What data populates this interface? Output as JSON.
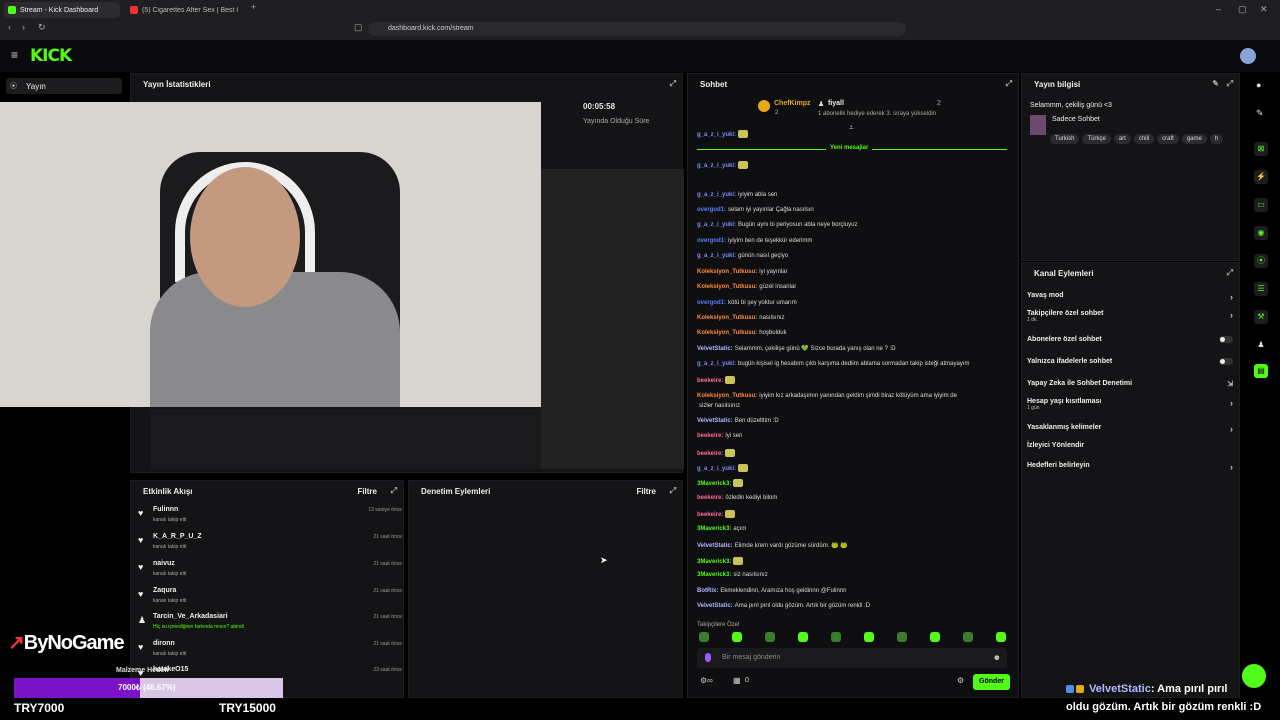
{
  "browser": {
    "tabs": [
      {
        "label": "Stream - Kick Dashboard"
      },
      {
        "label": "(5) Cigarettes After Sex | Best Of"
      }
    ],
    "url": "dashboard.kick.com/stream"
  },
  "header": {
    "logo": "KICK"
  },
  "sidebar": {
    "item": "Yayın"
  },
  "stats": {
    "title": "Yayın İstatistikleri",
    "duration": "00:05:58",
    "duration_label": "Yayında Olduğu Süre"
  },
  "chat": {
    "title": "Sohbet",
    "pinned_user": "ChefKimpz",
    "pinned_count": "2",
    "pinned_user2": "fiyall",
    "pinned_count2": "2",
    "pinned_note": "1 abonelik hediye ederek 3. sıraya yükseldin",
    "new_messages": "Yeni mesajlar",
    "messages": [
      {
        "user": "g_a_z_i_yuki:",
        "text": "",
        "color": "#7b8cff"
      },
      {
        "user": "g_a_z_i_yuki:",
        "text": "",
        "color": "#7b8cff"
      },
      {
        "user": "g_a_z_i_yuki:",
        "text": "iyiyim abla sen",
        "color": "#7b8cff"
      },
      {
        "user": "overgod1:",
        "text": "selam iyi yayınlar Çağla nasılsın",
        "color": "#5a7dff"
      },
      {
        "user": "g_a_z_i_yuki:",
        "text": "Bugün aynı bi periyosun abla neye borçluyuz",
        "color": "#7b8cff"
      },
      {
        "user": "overgod1:",
        "text": "iyiyim ben de teşekkür ederimm",
        "color": "#5a7dff"
      },
      {
        "user": "g_a_z_i_yuki:",
        "text": "günün nasıl geçiyo",
        "color": "#7b8cff"
      },
      {
        "user": "Koleksiyon_Tutkusu:",
        "text": "iyi yayınlar",
        "color": "#ff8a3d"
      },
      {
        "user": "Koleksiyon_Tutkusu:",
        "text": "güzel insanlar",
        "color": "#ff8a3d"
      },
      {
        "user": "overgod1:",
        "text": "kötü bi şey yoktur umarım",
        "color": "#5a7dff"
      },
      {
        "user": "Koleksiyon_Tutkusu:",
        "text": "nasılsınız",
        "color": "#ff8a3d"
      },
      {
        "user": "Koleksiyon_Tutkusu:",
        "text": "hoşbulduk",
        "color": "#ff8a3d"
      },
      {
        "user": "VelvetStatic:",
        "text": "Selammm, çekilişe günü 💚 Sizce burada yanış olan ne ? :D",
        "color": "#b5b5ff"
      },
      {
        "user": "g_a_z_i_yuki:",
        "text": "bugün kişisel ig hesabım çıktı karşıma dediim ablama sormadan takip isteği atmayayım",
        "color": "#7b8cff"
      },
      {
        "user": "beekeire:",
        "text": "",
        "color": "#ff6b9d"
      },
      {
        "user": "Koleksiyon_Tutkusu:",
        "text": "iyiyim kız arkadaşımın yanından geldim şimdi biraz kötüyüm ama iyiyim de",
        "color": "#ff8a3d"
      },
      {
        "user": "",
        "text": "sizler nasılsınız",
        "color": "#ff8a3d"
      },
      {
        "user": "VelvetStatic:",
        "text": "Ben düzelttim :D",
        "color": "#b5b5ff"
      },
      {
        "user": "beekeire:",
        "text": "iyi sen",
        "color": "#ff6b9d"
      },
      {
        "user": "beekeire:",
        "text": "",
        "color": "#ff6b9d"
      },
      {
        "user": "g_a_z_i_yuki:",
        "text": "",
        "color": "#7b8cff"
      },
      {
        "user": "3Maverick3:",
        "text": "",
        "color": "#53fc18"
      },
      {
        "user": "beekeire:",
        "text": "özledin kediyi bilom",
        "color": "#ff6b9d"
      },
      {
        "user": "beekeire:",
        "text": "",
        "color": "#ff6b9d"
      },
      {
        "user": "3Maverick3:",
        "text": "açım",
        "color": "#53fc18"
      },
      {
        "user": "VelvetStatic:",
        "text": "Elimde krem vardı gözüme sürdüm. 🐸 🐸",
        "color": "#b5b5ff"
      },
      {
        "user": "3Maverick3:",
        "text": "",
        "color": "#53fc18"
      },
      {
        "user": "3Maverick3:",
        "text": "siz nasılsınız",
        "color": "#53fc18"
      },
      {
        "user": "BotRix:",
        "text": "Ekmeklendinn, Aramıza hoş geldinnn @Fulinnn",
        "color": "#b5b5ff"
      },
      {
        "user": "VelvetStatic:",
        "text": "Ama pırıl pırıl oldu gözüm. Artık bir gözüm renkli :D",
        "color": "#b5b5ff"
      }
    ],
    "emote_label": "Takipçilere Özel",
    "input_placeholder": "Bir mesaj gönderin",
    "send_label": "Gönder",
    "count": "0"
  },
  "info": {
    "title": "Yayın bilgisi",
    "stream_title": "Selammm, çekiliş günü <3",
    "category": "Sadece Sohbet",
    "tags": [
      "Turkish",
      "Türkçe",
      "art",
      "chill",
      "craft",
      "game",
      "h"
    ]
  },
  "actions": {
    "title": "Kanal Eylemleri",
    "items": [
      {
        "label": "Yavaş mod",
        "sub": "",
        "kind": "chev"
      },
      {
        "label": "Takipçilere özel sohbet",
        "sub": "1 dk.",
        "kind": "chev"
      },
      {
        "label": "Abonelere özel sohbet",
        "sub": "",
        "kind": "toggle"
      },
      {
        "label": "Yalnızca ifadelerle sohbet",
        "sub": "",
        "kind": "toggle"
      },
      {
        "label": "Yapay Zeka ile Sohbet Denetimi",
        "sub": "",
        "kind": "ext"
      },
      {
        "label": "Hesap yaşı kısıtlaması",
        "sub": "1 gün",
        "kind": "chev"
      },
      {
        "label": "Yasaklanmış kelimeler",
        "sub": "",
        "kind": "chev"
      },
      {
        "label": "İzleyici Yönlendir",
        "sub": "",
        "kind": "none"
      },
      {
        "label": "Hedefleri belirleyin",
        "sub": "",
        "kind": "chev"
      }
    ]
  },
  "activity": {
    "title": "Etkinlik Akışı",
    "filter": "Filtre",
    "events": [
      {
        "name": "Fulinnn",
        "sub": "kanalı takip etti",
        "time": "13 saniye önce",
        "icon": "heart-icon"
      },
      {
        "name": "K_A_R_P_U_Z",
        "sub": "kanalı takip etti",
        "time": "21 saat önce",
        "icon": "heart-icon"
      },
      {
        "name": "naivuz",
        "sub": "kanalı takip etti",
        "time": "21 saat önce",
        "icon": "heart-icon"
      },
      {
        "name": "Zaqura",
        "sub": "kanalı takip etti",
        "time": "21 saat önce",
        "icon": "heart-icon"
      },
      {
        "name": "Tarcin_Ve_Arkadasiari",
        "sub": "Hiç su içmediğinin farkında mısın? abindi",
        "time": "21 saat önce",
        "icon": "person-icon"
      },
      {
        "name": "dironn",
        "sub": "kanalı takip etti",
        "time": "21 saat önce",
        "icon": "heart-icon"
      },
      {
        "name": "hatakeO15",
        "sub": "",
        "time": "23 saat önce",
        "icon": "heart-icon"
      }
    ]
  },
  "moderation": {
    "title": "Denetim Eylemleri",
    "filter": "Filtre"
  },
  "overlay": {
    "brand": "ByNoGame",
    "goal_label": "Malzeme Hedefi",
    "goal_value": "7000₺ (46.67%)",
    "goal_progress": 0.4667,
    "min_label": "TRY7000",
    "max_label": "TRY15000",
    "ticker_user": "VelvetStatic",
    "ticker_line1": ": Ama pırıl pırıl",
    "ticker_line2": "oldu gözüm. Artık bir gözüm renkli :D"
  },
  "colors": {
    "accent": "#53fc18",
    "panel": "#141416"
  }
}
